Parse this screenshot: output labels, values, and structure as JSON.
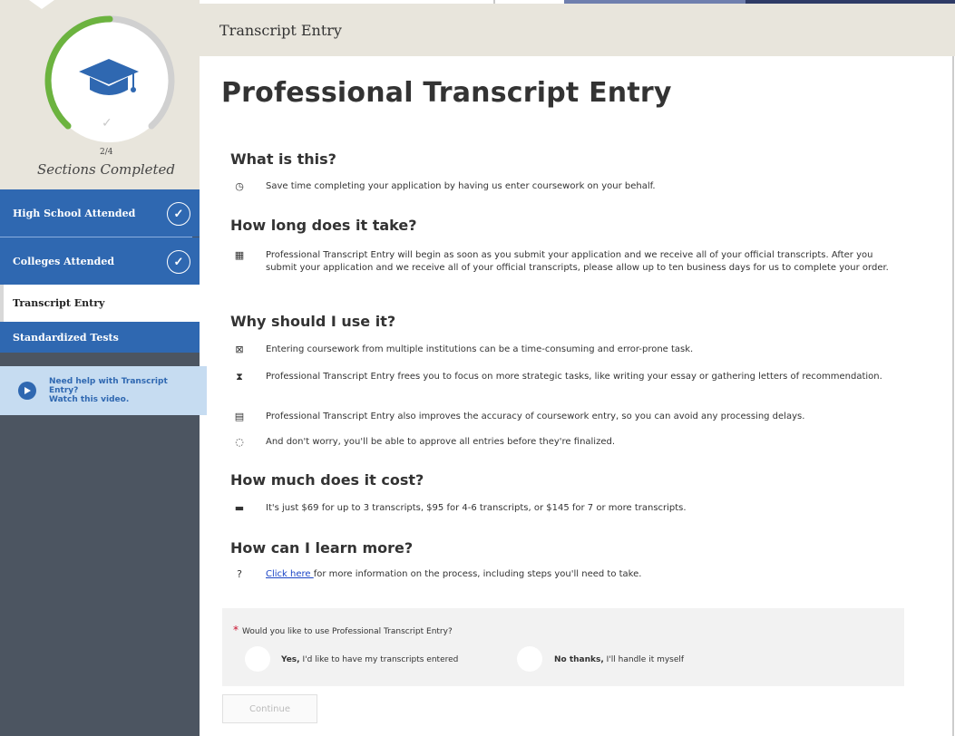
{
  "header": {
    "title": "Transcript Entry"
  },
  "progress": {
    "count": "2/4",
    "label": "Sections Completed",
    "fraction": 0.5
  },
  "sidebar": {
    "items": [
      {
        "label": "High School Attended",
        "completed": true
      },
      {
        "label": "Colleges Attended",
        "completed": true
      },
      {
        "label": "Transcript Entry",
        "active": true
      },
      {
        "label": "Standardized Tests"
      }
    ],
    "help": {
      "line1": "Need help with Transcript",
      "line2": "Entry?",
      "line3": "Watch this video."
    }
  },
  "main": {
    "title": "Professional Transcript Entry",
    "sections": [
      {
        "heading": "What is this?",
        "lines": [
          {
            "icon": "clock-icon",
            "text": "Save time completing your application by having us enter coursework on your behalf."
          }
        ]
      },
      {
        "heading": "How long does it take?",
        "lines": [
          {
            "icon": "calendar-icon",
            "text": "Professional Transcript Entry will begin as soon as you submit your application and we receive all of your official transcripts. After you submit your application and we receive all of your official transcripts, please allow up to ten business days for us to complete your order."
          }
        ]
      },
      {
        "heading": "Why should I use it?",
        "lines": [
          {
            "icon": "document-x-icon",
            "text": "Entering coursework from multiple institutions can be a time-consuming and error-prone task."
          },
          {
            "icon": "hourglass-icon",
            "text": "Professional Transcript Entry frees you to focus on more strategic tasks, like writing your essay or gathering letters of recommendation."
          },
          {
            "icon": "clipboard-icon",
            "text": "Professional Transcript Entry also improves the accuracy of coursework entry, so you can avoid any processing delays."
          },
          {
            "icon": "chat-check-icon",
            "text": "And don't worry, you'll be able to approve all entries before they're finalized."
          }
        ]
      },
      {
        "heading": "How much does it cost?",
        "lines": [
          {
            "icon": "credit-card-icon",
            "text": "It's just $69 for up to 3 transcripts, $95 for 4-6 transcripts, or $145 for 7 or more transcripts."
          }
        ]
      },
      {
        "heading": "How can I learn more?",
        "lines": [
          {
            "icon": "question-circle-icon",
            "link": "Click here ",
            "text": "for more information on the process, including steps you'll need to take."
          }
        ]
      }
    ],
    "question": {
      "required_mark": "*",
      "label": "Would you like to use Professional Transcript Entry?",
      "options": [
        {
          "bold": "Yes,",
          "rest": " I'd like to have my transcripts entered"
        },
        {
          "bold": "No thanks,",
          "rest": " I'll handle it myself"
        }
      ]
    },
    "continue_label": "Continue"
  },
  "colors": {
    "nav_blue": "#2f68b1",
    "sidebar_dark": "#4c5561",
    "progress_green": "#6cb33f",
    "header_beige": "#e8e5dc",
    "link_blue": "#1c46c6"
  }
}
